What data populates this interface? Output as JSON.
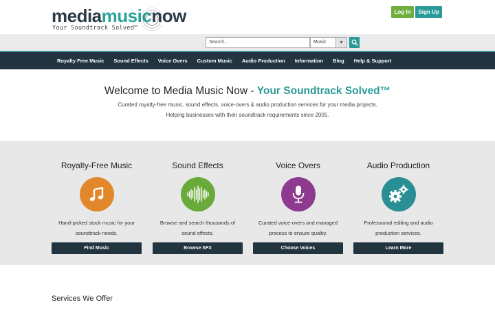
{
  "header": {
    "logo": {
      "part1": "media",
      "part2": "music",
      "part3": "now",
      "tagline": "Your Soundtrack Solved™"
    },
    "login_label": "Log In",
    "signup_label": "Sign Up"
  },
  "search": {
    "placeholder": "Search...",
    "category": "Music"
  },
  "nav": {
    "items": [
      "Royalty Free Music",
      "Sound Effects",
      "Voice Overs",
      "Custom Music",
      "Audio Production",
      "Information",
      "Blog",
      "Help & Support"
    ]
  },
  "welcome": {
    "title_prefix": "Welcome to Media Music Now - ",
    "title_accent": "Your Soundtrack Solved™",
    "line1": "Curated royalty-free music, sound effects, voice-overs & audio production services for your media projects.",
    "line2": "Helping businesses with their soundtrack requirements since 2005."
  },
  "features": [
    {
      "title": "Royalty-Free Music",
      "desc": "Hand-picked stock music for your soundtrack needs.",
      "button": "Find Music",
      "color": "#e2872a",
      "icon": "music-note-icon"
    },
    {
      "title": "Sound Effects",
      "desc": "Browse and search thousands of sound effects.",
      "button": "Browse SFX",
      "color": "#6aaa3a",
      "icon": "waveform-icon"
    },
    {
      "title": "Voice Overs",
      "desc": "Curated voice-overs and managed process to ensure quality.",
      "button": "Choose Voices",
      "color": "#8e3a8e",
      "icon": "microphone-icon"
    },
    {
      "title": "Audio Production",
      "desc": "Professional editing and audio production services.",
      "button": "Learn More",
      "color": "#2a8f95",
      "icon": "gears-icon"
    }
  ],
  "services_heading": "Services We Offer",
  "colors": {
    "nav_bg": "#21343f",
    "accent": "#2a9a98",
    "login": "#6fae3f"
  }
}
